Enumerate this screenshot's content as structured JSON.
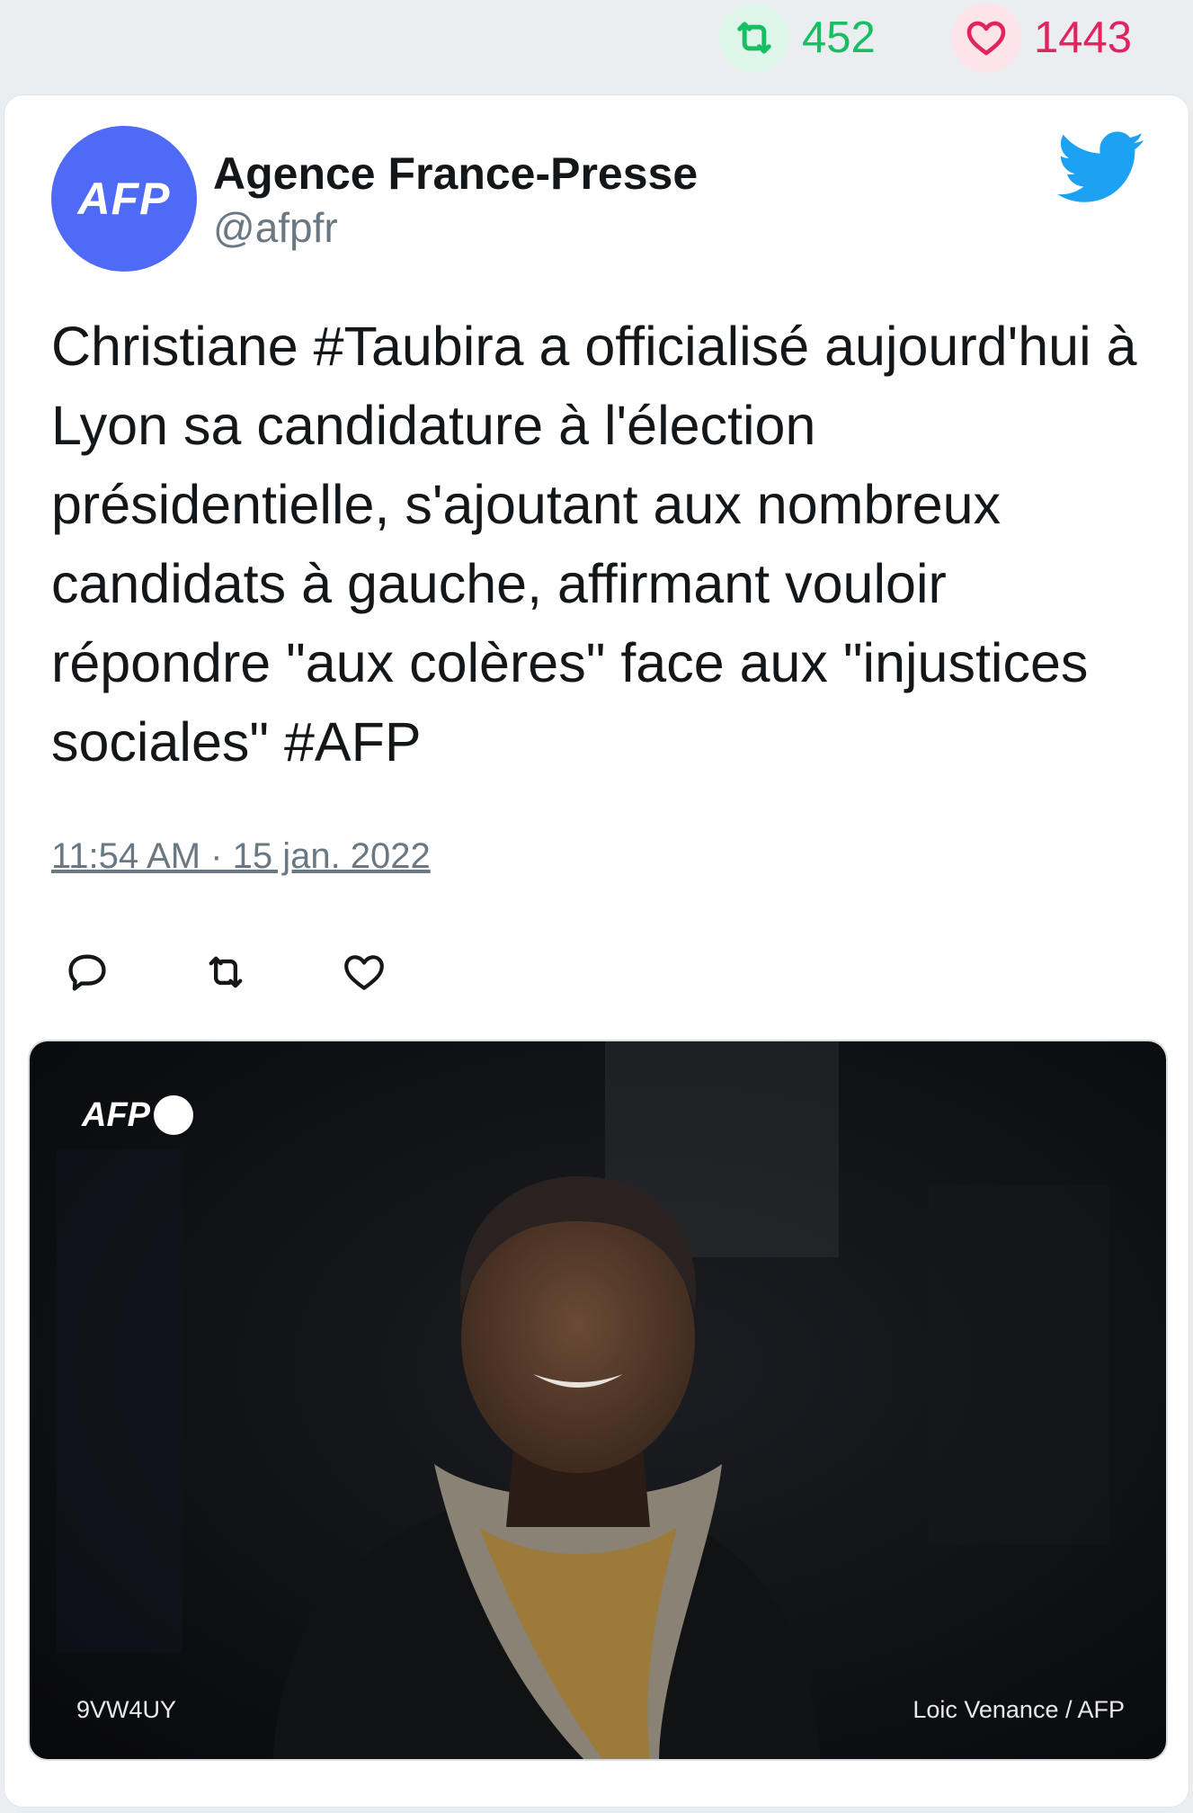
{
  "stats": {
    "retweet_count": "452",
    "like_count": "1443",
    "retweet_color": "#17bf63",
    "like_color": "#e0245e"
  },
  "author": {
    "avatar_text": "AFP",
    "name": "Agence France-Presse",
    "handle": "@afpfr",
    "avatar_color": "#4f6af7"
  },
  "tweet": {
    "text": "Christiane #Taubira a officialisé aujourd'hui à Lyon sa candidature à l'élection présidentielle, s'ajoutant aux nombreux candidats à gauche, affirmant vouloir répondre \"aux colères\" face aux \"injustices sociales\" #AFP",
    "timestamp": "11:54 AM · 15 jan. 2022"
  },
  "actions": {
    "icons": [
      "reply-icon",
      "retweet-icon",
      "like-icon"
    ]
  },
  "media": {
    "watermark_logo": "AFP",
    "photo_code": "9VW4UY",
    "photo_credit": "Loic Venance / AFP"
  },
  "brand": {
    "twitter_blue": "#1da1f2"
  }
}
